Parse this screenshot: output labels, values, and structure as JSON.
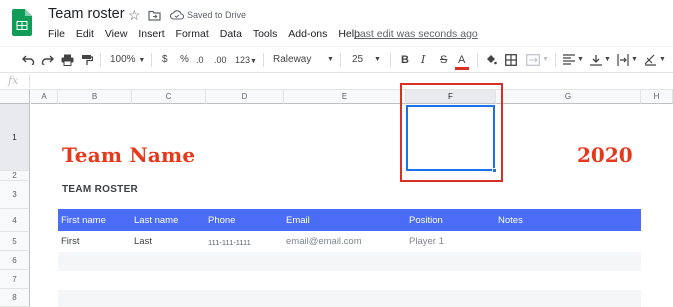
{
  "header": {
    "doc_title": "Team roster",
    "saved_status": "Saved to Drive",
    "last_edit": "Last edit was seconds ago",
    "icons": [
      "sheets-logo",
      "star-icon",
      "move-to-folder-icon",
      "cloud-done-icon"
    ]
  },
  "menu": [
    "File",
    "Edit",
    "View",
    "Insert",
    "Format",
    "Data",
    "Tools",
    "Add-ons",
    "Help"
  ],
  "toolbar": {
    "zoom": "100%",
    "currency": "$",
    "percent": "%",
    "decrease_decimal": ".0",
    "increase_decimal": ".00",
    "more_formats": "123",
    "font": "Raleway",
    "font_size": "25",
    "bold": "B",
    "italic": "I",
    "strike": "S",
    "text_color_letter": "A",
    "text_color": "#d93025"
  },
  "formula_bar": {
    "fx_label": "fx",
    "value": ""
  },
  "columns": [
    "A",
    "B",
    "C",
    "D",
    "E",
    "F",
    "G",
    "H"
  ],
  "rows": [
    "1",
    "2",
    "3",
    "4",
    "5",
    "6",
    "7",
    "8"
  ],
  "sheet": {
    "team_name": "Team Name",
    "year": "2020",
    "roster_title": "TEAM ROSTER",
    "table_headers": [
      "First name",
      "Last name",
      "Phone",
      "Email",
      "Position",
      "Notes"
    ],
    "row1": {
      "first": "First",
      "last": "Last",
      "phone": "111-111-1111",
      "email": "email@email.com",
      "position": "Player 1"
    },
    "selected_cell": "F1"
  },
  "colors": {
    "accent_red": "#e8381c",
    "header_blue": "#4a6cf7",
    "selection_blue": "#1a73e8",
    "highlight_red": "#d93025"
  }
}
